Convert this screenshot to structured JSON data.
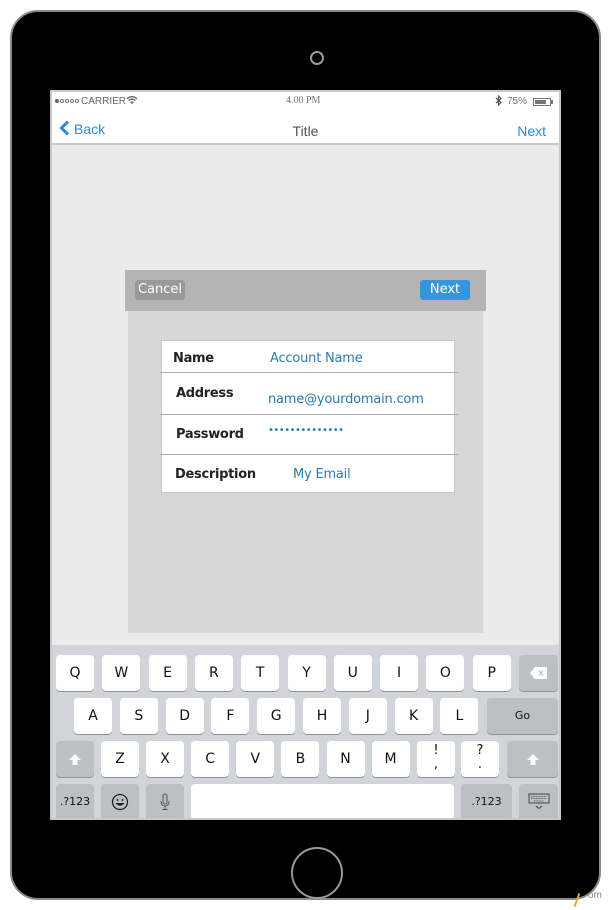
{
  "status_bar": {
    "signal_dots_filled": 1,
    "signal_dots_total": 5,
    "carrier": "CARRIER",
    "wifi_icon": "wifi-icon",
    "time": "4.00 PM",
    "bluetooth_icon": "bluetooth-icon",
    "battery_percent": "75%",
    "battery_level": 0.75
  },
  "nav_bar": {
    "back_label": "Back",
    "title": "Title",
    "next_label": "Next"
  },
  "dialog": {
    "cancel_label": "Cancel",
    "next_label": "Next",
    "fields": [
      {
        "label": "Name",
        "value": "Account Name"
      },
      {
        "label": "Address",
        "value": "name@yourdomain.com"
      },
      {
        "label": "Password",
        "value": "••••••••••••••"
      },
      {
        "label": "Description",
        "value": "My Email"
      }
    ]
  },
  "keyboard": {
    "row1": [
      "Q",
      "W",
      "E",
      "R",
      "T",
      "Y",
      "U",
      "I",
      "O",
      "P"
    ],
    "row2": [
      "A",
      "S",
      "D",
      "F",
      "G",
      "H",
      "J",
      "K",
      "L"
    ],
    "row3": [
      "Z",
      "X",
      "C",
      "V",
      "B",
      "N",
      "M"
    ],
    "punct1": "!\n,",
    "punct2": "?\n.",
    "go_label": "Go",
    "numbers_label": ".?123",
    "backspace_icon": "backspace-icon",
    "shift_icon": "shift-icon",
    "emoji_icon": "emoji-icon",
    "mic_icon": "microphone-icon",
    "hide_keyboard_icon": "hide-keyboard-icon"
  },
  "colors": {
    "accent": "#2a8be0",
    "next_button": "#3696dc",
    "field_value": "#2a7ab0"
  },
  "watermark": "om"
}
